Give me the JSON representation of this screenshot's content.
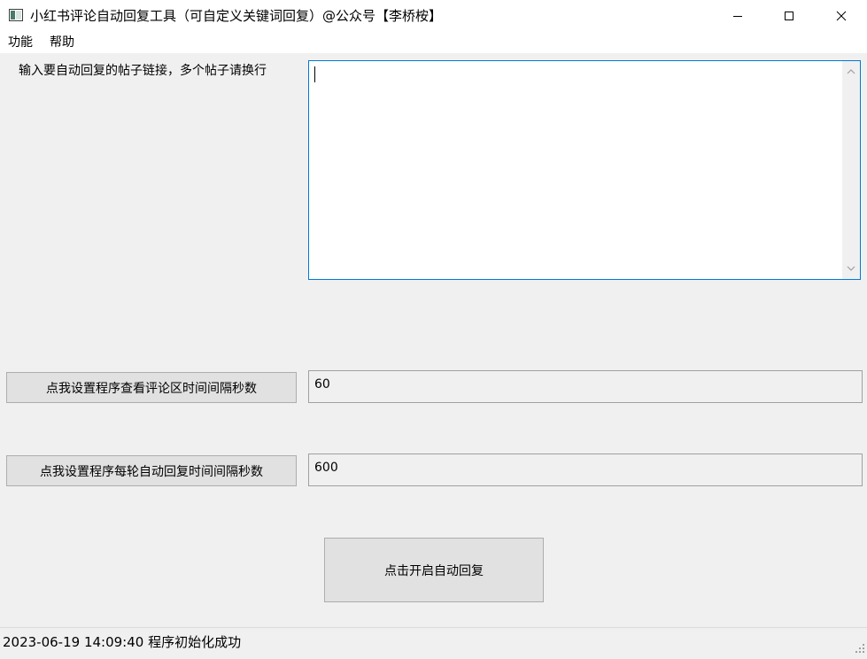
{
  "window": {
    "title": "小红书评论自动回复工具（可自定义关键词回复）@公众号【李桥桉】",
    "icons": [
      "app-window-icon",
      "minimize-icon",
      "maximize-icon",
      "close-icon"
    ]
  },
  "menu": {
    "items": [
      {
        "label": "功能"
      },
      {
        "label": "帮助"
      }
    ]
  },
  "links_section": {
    "label": "输入要自动回复的帖子链接，多个帖子请换行",
    "value": ""
  },
  "check_interval": {
    "button_label": "点我设置程序查看评论区时间间隔秒数",
    "value": "60"
  },
  "reply_interval": {
    "button_label": "点我设置程序每轮自动回复时间间隔秒数",
    "value": "600"
  },
  "start_button": {
    "label": "点击开启自动回复"
  },
  "status": {
    "text": "2023-06-19 14:09:40 程序初始化成功"
  },
  "colors": {
    "background": "#f0f0f0",
    "focus_border": "#0078d7",
    "button_face": "#e1e1e1"
  }
}
